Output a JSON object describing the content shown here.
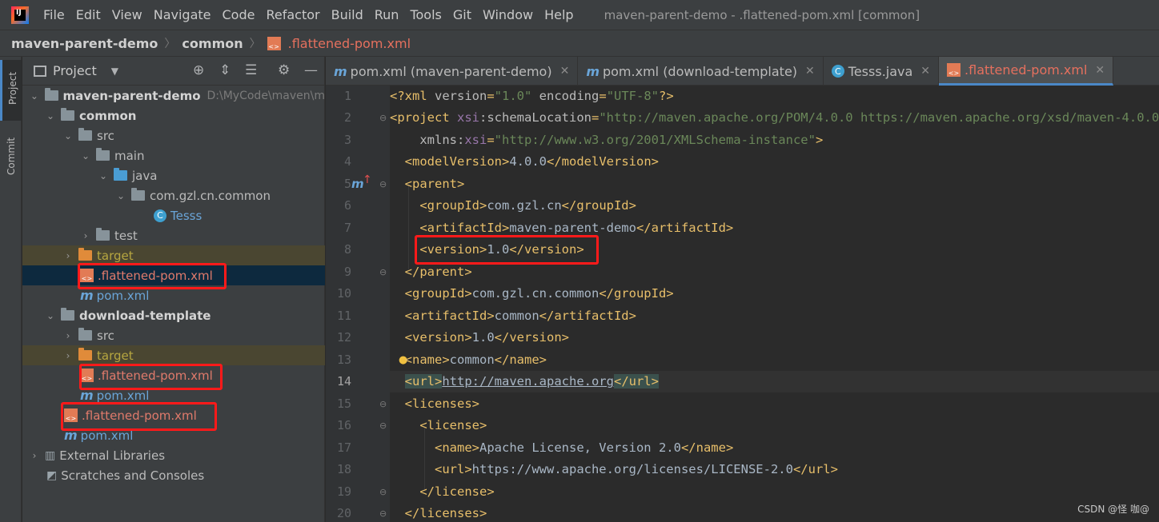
{
  "menubar": {
    "items": [
      "File",
      "Edit",
      "View",
      "Navigate",
      "Code",
      "Refactor",
      "Build",
      "Run",
      "Tools",
      "Git",
      "Window",
      "Help"
    ],
    "window_title": "maven-parent-demo - .flattened-pom.xml [common]"
  },
  "breadcrumb": {
    "items": [
      "maven-parent-demo",
      "common"
    ],
    "file": ".flattened-pom.xml"
  },
  "toolstrip": {
    "project": "Project",
    "commit": "Commit"
  },
  "project_panel": {
    "title": "Project",
    "tree": [
      {
        "label": "maven-parent-demo",
        "extra": "D:\\MyCode\\maven\\m"
      },
      {
        "label": "common"
      },
      {
        "label": "src"
      },
      {
        "label": "main"
      },
      {
        "label": "java"
      },
      {
        "label": "com.gzl.cn.common"
      },
      {
        "label": "Tesss"
      },
      {
        "label": "test"
      },
      {
        "label": "target"
      },
      {
        "label": ".flattened-pom.xml"
      },
      {
        "label": "pom.xml"
      },
      {
        "label": "download-template"
      },
      {
        "label": "src"
      },
      {
        "label": "target"
      },
      {
        "label": ".flattened-pom.xml"
      },
      {
        "label": "pom.xml"
      },
      {
        "label": ".flattened-pom.xml"
      },
      {
        "label": "pom.xml"
      },
      {
        "label": "External Libraries"
      },
      {
        "label": "Scratches and Consoles"
      }
    ]
  },
  "editor_tabs": [
    {
      "label": "pom.xml (maven-parent-demo)",
      "icon": "maven-icon"
    },
    {
      "label": "pom.xml (download-template)",
      "icon": "maven-icon"
    },
    {
      "label": "Tesss.java",
      "icon": "class-icon"
    },
    {
      "label": ".flattened-pom.xml",
      "icon": "xml-icon",
      "active": true
    }
  ],
  "editor": {
    "line_numbers": [
      "1",
      "2",
      "3",
      "4",
      "5",
      "6",
      "7",
      "8",
      "9",
      "10",
      "11",
      "12",
      "13",
      "14",
      "15",
      "16",
      "17",
      "18",
      "19",
      "20"
    ],
    "current_line": "14"
  },
  "watermark": "CSDN @怪 咖@",
  "colors": {
    "tag": "#e8bf6a",
    "value": "#6a8759",
    "namespace": "#9876aa",
    "text": "#a9b7c6",
    "highlight_box": "#ff1a1a",
    "accent": "#4a88c7"
  }
}
